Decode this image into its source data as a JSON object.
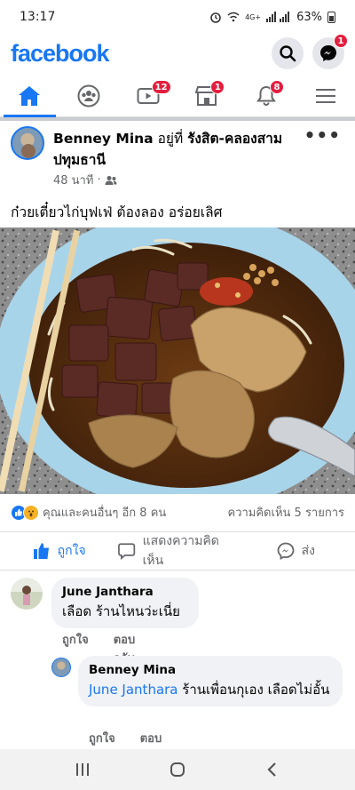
{
  "status_bar": {
    "time": "13:17",
    "network": "4G+",
    "battery": "63%"
  },
  "header": {
    "logo": "facebook",
    "search_icon": "search-icon",
    "messenger_icon": "messenger-icon",
    "messenger_badge": "1"
  },
  "tabs": [
    {
      "name": "home",
      "icon": "home-icon",
      "badge": ""
    },
    {
      "name": "groups",
      "icon": "groups-icon",
      "badge": ""
    },
    {
      "name": "watch",
      "icon": "video-icon",
      "badge": "12"
    },
    {
      "name": "marketplace",
      "icon": "store-icon",
      "badge": "1"
    },
    {
      "name": "notifications",
      "icon": "bell-icon",
      "badge": "8"
    },
    {
      "name": "menu",
      "icon": "menu-icon",
      "badge": ""
    }
  ],
  "post": {
    "author": "Benney Mina",
    "at_text": " อยู่ที่ ",
    "location": "รังสิต-คลองสาม ปทุมธานี",
    "time": "48 นาที",
    "audience_icon": "friends-icon",
    "text": "ก๋วยเตี๋ยวไก่บุฟเฟ่ ต้องลอง อร่อยเลิศ",
    "reactions_text": "คุณและคนอื่นๆ อีก 8 คน",
    "comments_count": "ความคิดเห็น 5 รายการ",
    "actions": {
      "like": "ถูกใจ",
      "comment": "แสดงความคิดเห็น",
      "share": "ส่ง"
    }
  },
  "comments": [
    {
      "name": "June Janthara",
      "text": "เลือด ร้านไหนว่ะเนี่ย",
      "like": "ถูกใจ",
      "reply": "ตอบกลับ"
    },
    {
      "name": "Benney Mina",
      "mention": "June Janthara",
      "text": " ร้านเพื่อนกุเอง เลือดไม่อั้น",
      "like": "ถูกใจ",
      "reply": "ตอบกลับ"
    }
  ],
  "colors": {
    "brand": "#1877f2",
    "badge": "#e41e3f"
  }
}
